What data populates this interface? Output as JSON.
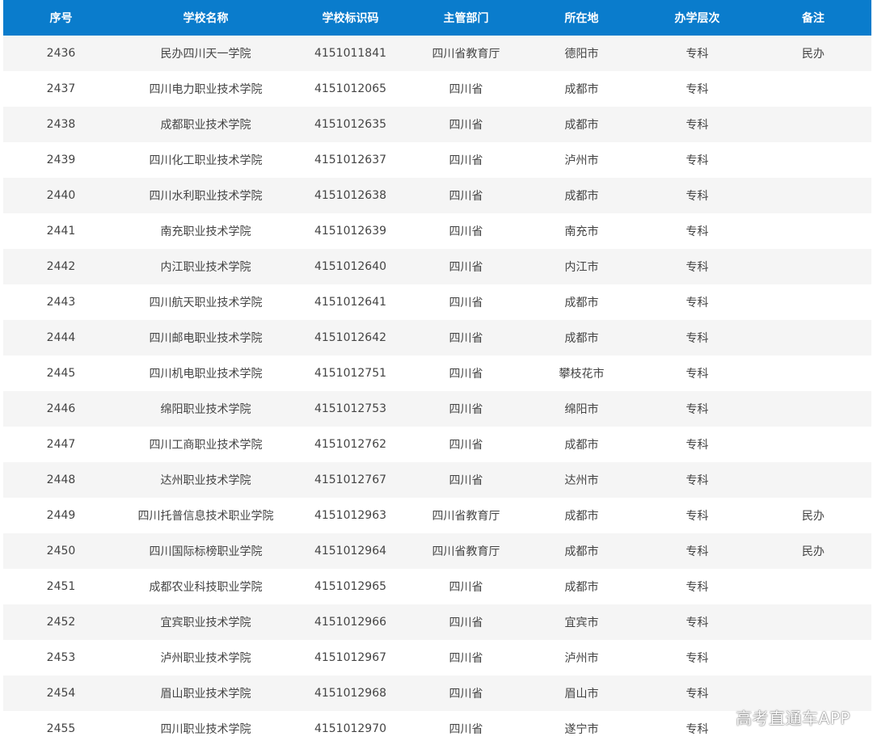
{
  "table": {
    "headers": [
      "序号",
      "学校名称",
      "学校标识码",
      "主管部门",
      "所在地",
      "办学层次",
      "备注"
    ],
    "rows": [
      [
        "2436",
        "民办四川天一学院",
        "4151011841",
        "四川省教育厅",
        "德阳市",
        "专科",
        "民办"
      ],
      [
        "2437",
        "四川电力职业技术学院",
        "4151012065",
        "四川省",
        "成都市",
        "专科",
        ""
      ],
      [
        "2438",
        "成都职业技术学院",
        "4151012635",
        "四川省",
        "成都市",
        "专科",
        ""
      ],
      [
        "2439",
        "四川化工职业技术学院",
        "4151012637",
        "四川省",
        "泸州市",
        "专科",
        ""
      ],
      [
        "2440",
        "四川水利职业技术学院",
        "4151012638",
        "四川省",
        "成都市",
        "专科",
        ""
      ],
      [
        "2441",
        "南充职业技术学院",
        "4151012639",
        "四川省",
        "南充市",
        "专科",
        ""
      ],
      [
        "2442",
        "内江职业技术学院",
        "4151012640",
        "四川省",
        "内江市",
        "专科",
        ""
      ],
      [
        "2443",
        "四川航天职业技术学院",
        "4151012641",
        "四川省",
        "成都市",
        "专科",
        ""
      ],
      [
        "2444",
        "四川邮电职业技术学院",
        "4151012642",
        "四川省",
        "成都市",
        "专科",
        ""
      ],
      [
        "2445",
        "四川机电职业技术学院",
        "4151012751",
        "四川省",
        "攀枝花市",
        "专科",
        ""
      ],
      [
        "2446",
        "绵阳职业技术学院",
        "4151012753",
        "四川省",
        "绵阳市",
        "专科",
        ""
      ],
      [
        "2447",
        "四川工商职业技术学院",
        "4151012762",
        "四川省",
        "成都市",
        "专科",
        ""
      ],
      [
        "2448",
        "达州职业技术学院",
        "4151012767",
        "四川省",
        "达州市",
        "专科",
        ""
      ],
      [
        "2449",
        "四川托普信息技术职业学院",
        "4151012963",
        "四川省教育厅",
        "成都市",
        "专科",
        "民办"
      ],
      [
        "2450",
        "四川国际标榜职业学院",
        "4151012964",
        "四川省教育厅",
        "成都市",
        "专科",
        "民办"
      ],
      [
        "2451",
        "成都农业科技职业学院",
        "4151012965",
        "四川省",
        "成都市",
        "专科",
        ""
      ],
      [
        "2452",
        "宜宾职业技术学院",
        "4151012966",
        "四川省",
        "宜宾市",
        "专科",
        ""
      ],
      [
        "2453",
        "泸州职业技术学院",
        "4151012967",
        "四川省",
        "泸州市",
        "专科",
        ""
      ],
      [
        "2454",
        "眉山职业技术学院",
        "4151012968",
        "四川省",
        "眉山市",
        "专科",
        ""
      ],
      [
        "2455",
        "四川职业技术学院",
        "4151012970",
        "四川省",
        "遂宁市",
        "专科",
        ""
      ]
    ]
  },
  "watermark": "高考直通车APP",
  "colors": {
    "header_bg": "#0a7ccc",
    "header_text": "#ffffff",
    "row_stripe": "#f5f5f5",
    "cell_text": "#444444"
  }
}
